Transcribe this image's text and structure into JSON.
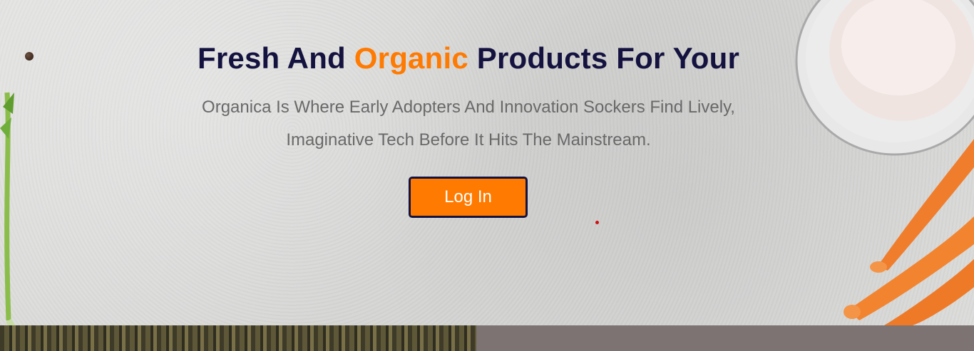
{
  "hero": {
    "title_part1": "Fresh And ",
    "title_accent": "Organic",
    "title_part2": " Products For Your",
    "subtitle_line1": "Organica Is Where Early Adopters And Innovation Sockers Find Lively,",
    "subtitle_line2": "Imaginative Tech Before It Hits The Mainstream.",
    "login_label": "Log In"
  },
  "colors": {
    "title": "#14123f",
    "accent": "#ff7a00",
    "subtitle": "#696969",
    "button_bg": "#ff7a00",
    "button_border": "#14123f",
    "strip_right": "#7d7373"
  },
  "icons": [
    "pepper-decoration",
    "herb-decoration",
    "salt-bowl-decoration",
    "carrots-decoration"
  ]
}
